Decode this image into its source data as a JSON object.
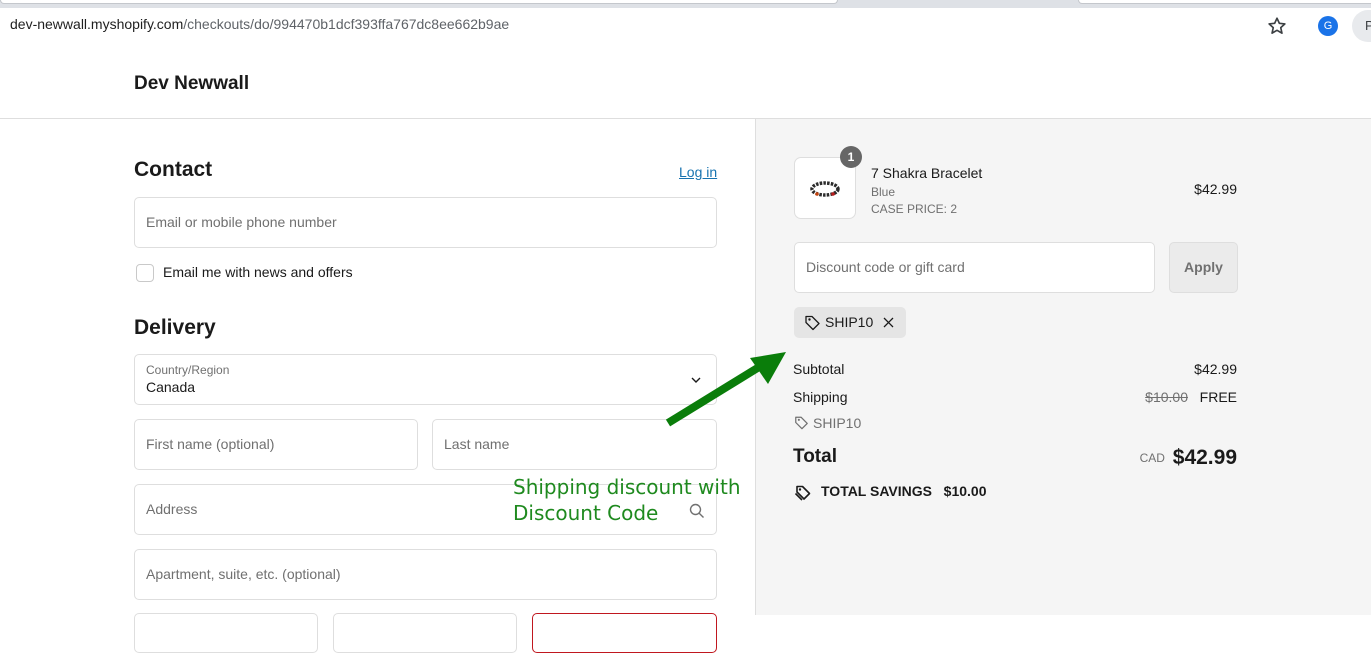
{
  "browser": {
    "url_host": "dev-newwall.myshopify.com",
    "url_path": "/checkouts/do/994470b1dcf393ffa767dc8ee662b9ae",
    "avatar_letter": "G",
    "profile_letter": "P"
  },
  "store": {
    "name": "Dev Newwall"
  },
  "contact": {
    "title": "Contact",
    "login_link": "Log in",
    "email_placeholder": "Email or mobile phone number",
    "newsletter_label": "Email me with news and offers"
  },
  "delivery": {
    "title": "Delivery",
    "country_label": "Country/Region",
    "country_value": "Canada",
    "first_name_placeholder": "First name (optional)",
    "last_name_placeholder": "Last name",
    "address_placeholder": "Address",
    "apartment_placeholder": "Apartment, suite, etc. (optional)"
  },
  "cart": {
    "item": {
      "quantity": "1",
      "name": "7 Shakra Bracelet",
      "variant": "Blue",
      "case_price": "CASE PRICE: 2",
      "price": "$42.99"
    },
    "discount_placeholder": "Discount code or gift card",
    "apply_label": "Apply",
    "applied_code": "SHIP10",
    "subtotal_label": "Subtotal",
    "subtotal_value": "$42.99",
    "shipping_label": "Shipping",
    "shipping_original": "$10.00",
    "shipping_value": "FREE",
    "shipping_code": "SHIP10",
    "total_label": "Total",
    "currency": "CAD",
    "total_value": "$42.99",
    "savings_label": "TOTAL SAVINGS",
    "savings_value": "$10.00"
  },
  "annotation": {
    "line1": "Shipping discount with",
    "line2": "Discount Code",
    "color": "#0a7d0a"
  },
  "colors": {
    "link": "#1773b0",
    "summary_bg": "#f5f5f5",
    "arrow": "#0a7d0a"
  }
}
